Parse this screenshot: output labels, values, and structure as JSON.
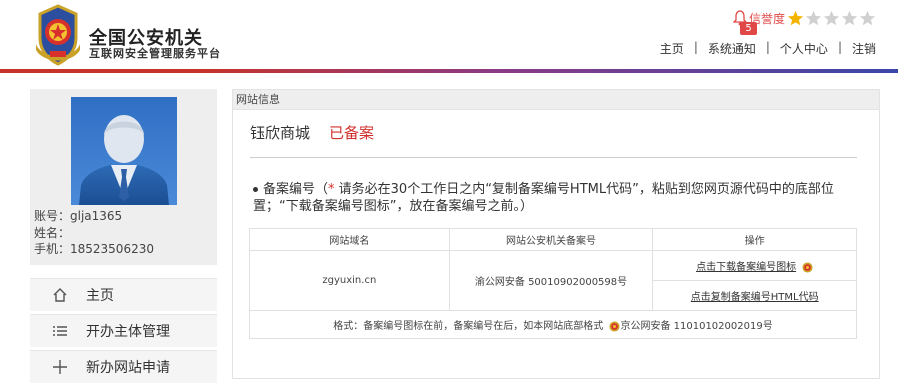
{
  "header": {
    "title": "全国公安机关",
    "subtitle": "互联网安全管理服务平台",
    "credit_label": "信誉度",
    "notification_count": "5",
    "credit_stars": 1,
    "credit_stars_max": 5,
    "nav": {
      "home": "主页",
      "notice": "系统通知",
      "personal": "个人中心",
      "logout": "注销",
      "separator": "|"
    }
  },
  "profile": {
    "account": "账号：glja1365",
    "name": "姓名：",
    "phone": "手机：18523506230"
  },
  "menu": [
    {
      "label": "主页",
      "icon": "home-icon"
    },
    {
      "label": "开办主体管理",
      "icon": "list-icon"
    },
    {
      "label": "新办网站申请",
      "icon": "plus-icon"
    }
  ],
  "main": {
    "section_title": "网站信息",
    "site_name": "钰欣商城",
    "site_status": "已备案",
    "notice_prefix": "备案编号（",
    "notice_star": "*",
    "notice_body": " 请务必在30个工作日之内“复制备案编号HTML代码”，粘贴到您网页源代码中的底部位置；“下载备案编号图标”，放在备案编号之前。）",
    "table": {
      "headers": [
        "网站域名",
        "网站公安机关备案号",
        "操作"
      ],
      "domain": "zgyuxin.cn",
      "record_no": "渝公网安备 50010902000598号",
      "action_download": "点击下载备案编号图标",
      "action_copy": "点击复制备案编号HTML代码",
      "format_prefix": "格式：备案编号图标在前，备案编号在后，如本网站底部格式",
      "format_example": "京公网安备 11010102002019号"
    }
  },
  "colors": {
    "accent_red": "#d0312d",
    "star_gold": "#f5b400",
    "star_gray": "#d0d0d0"
  }
}
